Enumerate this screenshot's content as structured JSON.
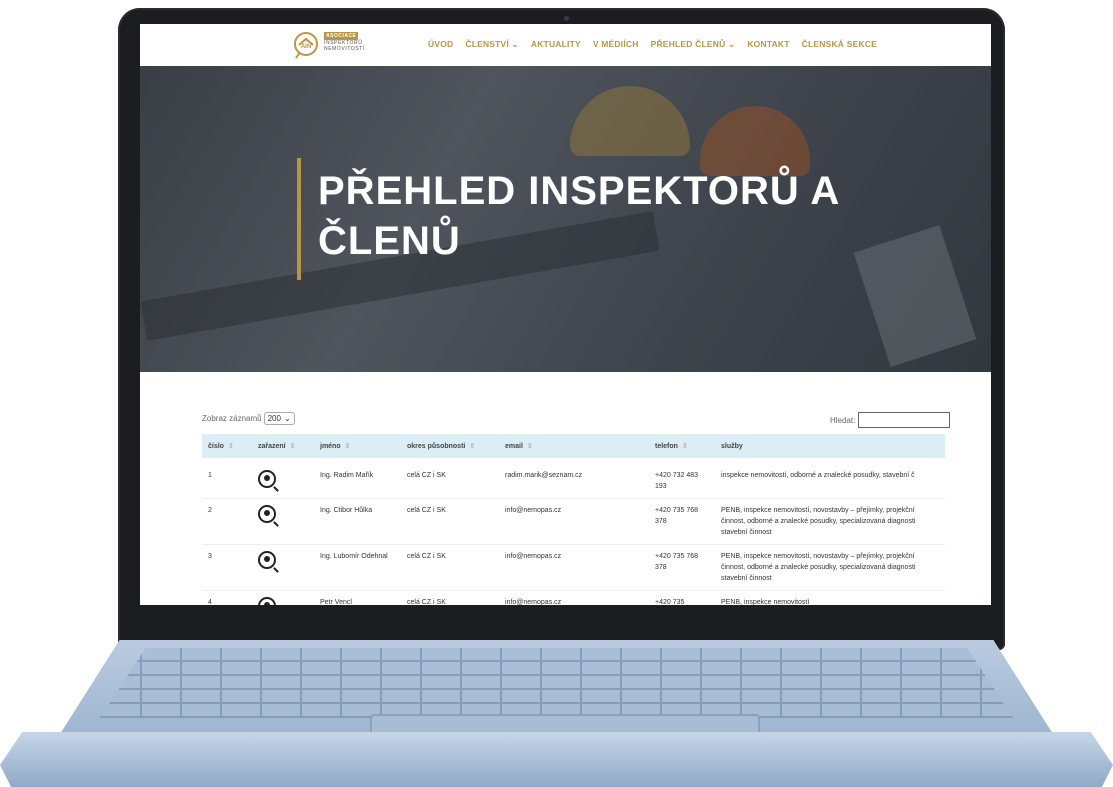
{
  "nav": {
    "logo_badge": "ASOCIACE",
    "logo_line1": "INSPEKTORŮ",
    "logo_line2": "NEMOVITOSTÍ",
    "logo_mark": "AIN",
    "items": [
      "ÚVOD",
      "ČLENSTVÍ ⌄",
      "AKTUALITY",
      "V MÉDIÍCH",
      "PŘEHLED ČLENŮ ⌄",
      "KONTAKT",
      "ČLENSKÁ SEKCE"
    ]
  },
  "hero": {
    "title_line1": "PŘEHLED INSPEKTORŮ A",
    "title_line2": "ČLENŮ"
  },
  "table_controls": {
    "show_label": "Zobraz záznamů",
    "show_value": "200",
    "search_label": "Hledat:"
  },
  "table": {
    "headers": [
      "číslo",
      "zařazení",
      "jméno",
      "okres působnosti",
      "email",
      "telefon",
      "služby"
    ],
    "rows": [
      {
        "num": "1",
        "name": "Ing. Radim Mařík",
        "district": "celá CZ i SK",
        "email": "radim.marik@seznam.cz",
        "phone": "+420 732 483 193",
        "services": "inspekce nemovitostí, odborné a znalecké posudky, stavební č"
      },
      {
        "num": "2",
        "name": "Ing. Ctibor Hůlka",
        "district": "celá CZ i SK",
        "email": "info@nemopas.cz",
        "phone": "+420 735 768 378",
        "services": "PENB, inspekce nemovitostí, novostavby – přejímky, projekční činnost, odborné a znalecké posudky, specializovaná diagnosti stavební činnost"
      },
      {
        "num": "3",
        "name": "Ing. Lubomír Odehnal",
        "district": "celá CZ i SK",
        "email": "info@nemopas.cz",
        "phone": "+420 735 768 378",
        "services": "PENB, inspekce nemovitostí, novostavby – přejímky, projekční činnost, odborné a znalecké posudky, specializovaná diagnosti stavební činnost"
      },
      {
        "num": "4",
        "name": "Petr Vencl",
        "district": "celá CZ i SK",
        "email": "info@nemopas.cz",
        "phone": "+420 735",
        "services": "PENB, inspekce nemovitostí"
      }
    ]
  },
  "colors": {
    "gold": "#b99546",
    "header_row": "#dbeef5"
  }
}
